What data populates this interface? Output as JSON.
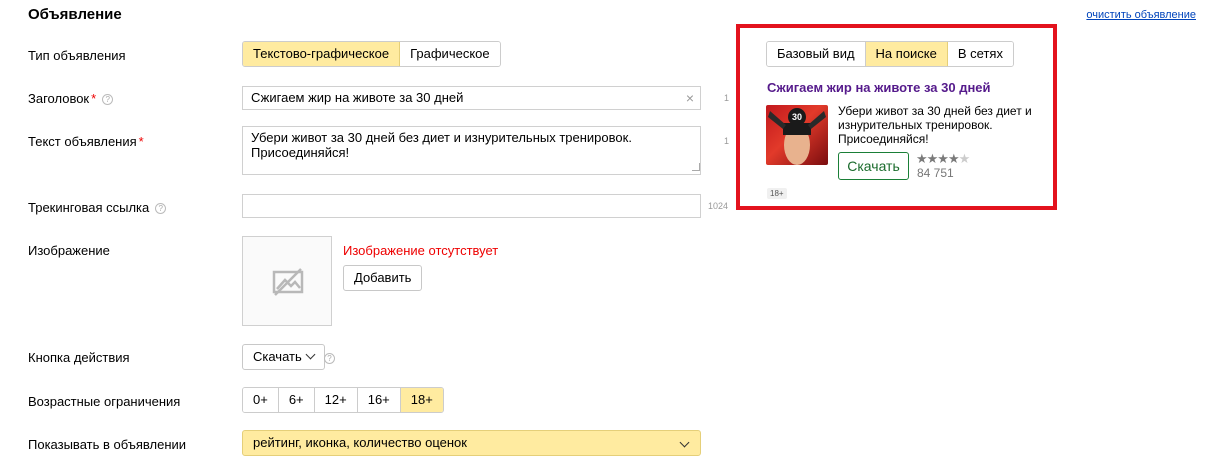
{
  "header": {
    "title": "Объявление",
    "clear_link": "очистить объявление"
  },
  "labels": {
    "type": "Тип объявления",
    "headline": "Заголовок",
    "text": "Текст объявления",
    "tracking": "Трекинговая ссылка",
    "image": "Изображение",
    "action_button": "Кнопка действия",
    "age": "Возрастные ограничения",
    "show_in_ad": "Показывать в объявлении"
  },
  "required_mark": "*",
  "help_glyph": "?",
  "ad_type": {
    "options": [
      "Текстово-графическое",
      "Графическое"
    ],
    "selected": "Текстово-графическое"
  },
  "headline": {
    "value": "Сжигаем жир на животе за 30 дней",
    "counter": "1",
    "clear_glyph": "×"
  },
  "body_text": {
    "value": "Убери живот за 30 дней без диет и изнурительных тренировок.\nПрисоединяйся!",
    "counter": "1"
  },
  "tracking": {
    "value": "",
    "counter": "1024"
  },
  "image": {
    "missing_text": "Изображение отсутствует",
    "add_button": "Добавить"
  },
  "action_button": {
    "value": "Скачать"
  },
  "age": {
    "options": [
      "0+",
      "6+",
      "12+",
      "16+",
      "18+"
    ],
    "selected": "18+"
  },
  "show_in_ad": {
    "value": "рейтинг, иконка, количество оценок"
  },
  "preview": {
    "tabs": [
      "Базовый вид",
      "На поиске",
      "В сетях"
    ],
    "selected_tab": "На поиске",
    "title": "Сжигаем жир на животе за 30 дней",
    "text": "Убери живот за 30 дней без диет и изнурительных тренировок. Присоединяйся!",
    "button": "Скачать",
    "stars_full": "★★★★",
    "stars_dim": "★",
    "rating_count": "84 751",
    "age_badge": "18+",
    "icon_number": "30"
  },
  "colors": {
    "accent_yellow": "#ffeba0",
    "required_red": "#e00",
    "preview_border": "#e3121d",
    "link": "#04b",
    "preview_title": "#551a8b"
  }
}
